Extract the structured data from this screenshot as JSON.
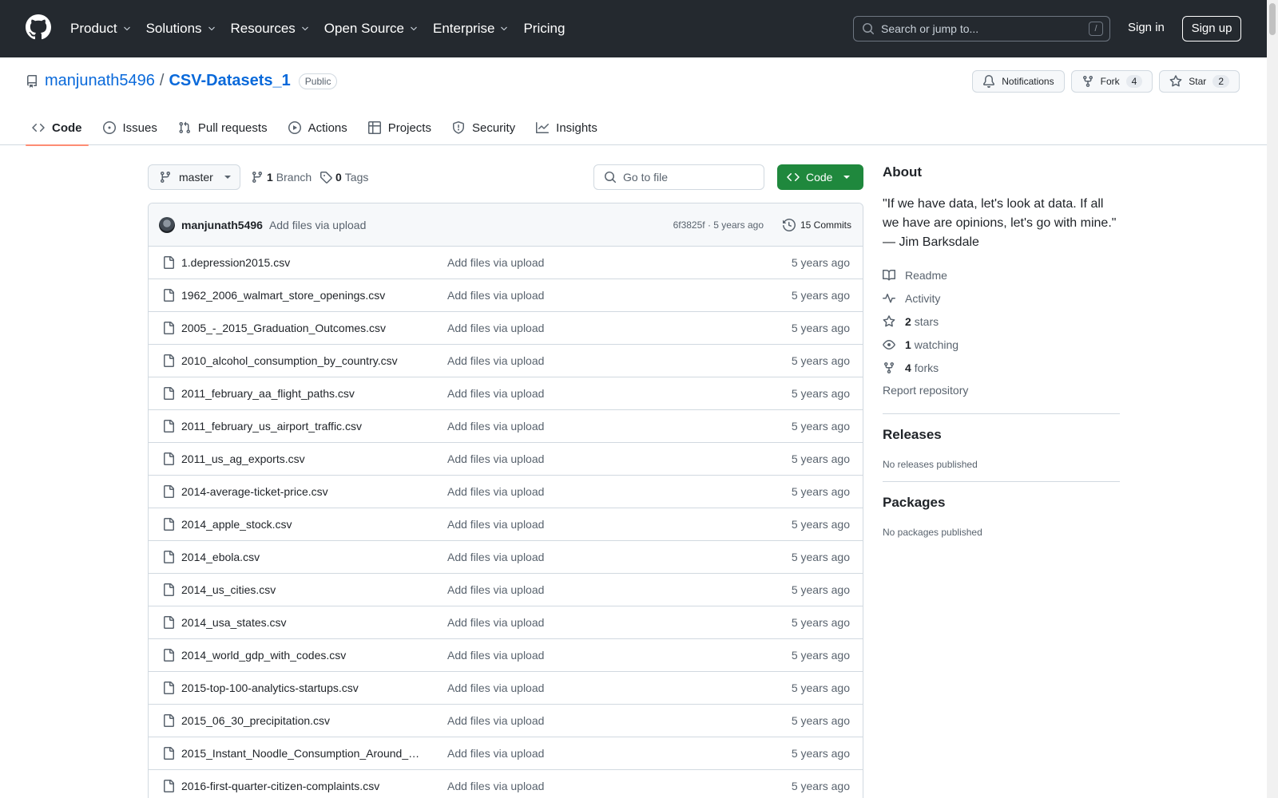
{
  "header": {
    "nav": [
      {
        "label": "Product",
        "has_menu": true
      },
      {
        "label": "Solutions",
        "has_menu": true
      },
      {
        "label": "Resources",
        "has_menu": true
      },
      {
        "label": "Open Source",
        "has_menu": true
      },
      {
        "label": "Enterprise",
        "has_menu": true
      },
      {
        "label": "Pricing",
        "has_menu": false
      }
    ],
    "search_placeholder": "Search or jump to...",
    "search_shortcut": "/",
    "sign_in": "Sign in",
    "sign_up": "Sign up"
  },
  "repo": {
    "owner": "manjunath5496",
    "separator": "/",
    "name": "CSV-Datasets_1",
    "visibility": "Public",
    "notifications_label": "Notifications",
    "fork_label": "Fork",
    "fork_count": "4",
    "star_label": "Star",
    "star_count": "2"
  },
  "tabs": [
    {
      "label": "Code",
      "icon": "code-icon",
      "active": true
    },
    {
      "label": "Issues",
      "icon": "issue-icon",
      "active": false
    },
    {
      "label": "Pull requests",
      "icon": "pull-request-icon",
      "active": false
    },
    {
      "label": "Actions",
      "icon": "play-icon",
      "active": false
    },
    {
      "label": "Projects",
      "icon": "table-icon",
      "active": false
    },
    {
      "label": "Security",
      "icon": "shield-icon",
      "active": false
    },
    {
      "label": "Insights",
      "icon": "graph-icon",
      "active": false
    }
  ],
  "toolbar": {
    "branch": "master",
    "branch_count": "1",
    "branch_label": "Branch",
    "tag_count": "0",
    "tag_label": "Tags",
    "goto_placeholder": "Go to file",
    "code_button": "Code"
  },
  "commit": {
    "author": "manjunath5496",
    "message": "Add files via upload",
    "meta": "6f3825f · 5 years ago",
    "commits_label": "15 Commits"
  },
  "files": [
    {
      "name": "1.depression2015.csv",
      "message": "Add files via upload",
      "age": "5 years ago"
    },
    {
      "name": "1962_2006_walmart_store_openings.csv",
      "message": "Add files via upload",
      "age": "5 years ago"
    },
    {
      "name": "2005_-_2015_Graduation_Outcomes.csv",
      "message": "Add files via upload",
      "age": "5 years ago"
    },
    {
      "name": "2010_alcohol_consumption_by_country.csv",
      "message": "Add files via upload",
      "age": "5 years ago"
    },
    {
      "name": "2011_february_aa_flight_paths.csv",
      "message": "Add files via upload",
      "age": "5 years ago"
    },
    {
      "name": "2011_february_us_airport_traffic.csv",
      "message": "Add files via upload",
      "age": "5 years ago"
    },
    {
      "name": "2011_us_ag_exports.csv",
      "message": "Add files via upload",
      "age": "5 years ago"
    },
    {
      "name": "2014-average-ticket-price.csv",
      "message": "Add files via upload",
      "age": "5 years ago"
    },
    {
      "name": "2014_apple_stock.csv",
      "message": "Add files via upload",
      "age": "5 years ago"
    },
    {
      "name": "2014_ebola.csv",
      "message": "Add files via upload",
      "age": "5 years ago"
    },
    {
      "name": "2014_us_cities.csv",
      "message": "Add files via upload",
      "age": "5 years ago"
    },
    {
      "name": "2014_usa_states.csv",
      "message": "Add files via upload",
      "age": "5 years ago"
    },
    {
      "name": "2014_world_gdp_with_codes.csv",
      "message": "Add files via upload",
      "age": "5 years ago"
    },
    {
      "name": "2015-top-100-analytics-startups.csv",
      "message": "Add files via upload",
      "age": "5 years ago"
    },
    {
      "name": "2015_06_30_precipitation.csv",
      "message": "Add files via upload",
      "age": "5 years ago"
    },
    {
      "name": "2015_Instant_Noodle_Consumption_Around_…",
      "message": "Add files via upload",
      "age": "5 years ago"
    },
    {
      "name": "2016-first-quarter-citizen-complaints.csv",
      "message": "Add files via upload",
      "age": "5 years ago"
    }
  ],
  "about": {
    "title": "About",
    "description": "\"If we have data, let's look at data. If all we have are opinions, let's go with mine.\" — Jim Barksdale",
    "readme": "Readme",
    "activity": "Activity",
    "stars_count": "2",
    "stars_label": "stars",
    "watching_count": "1",
    "watching_label": "watching",
    "forks_count": "4",
    "forks_label": "forks",
    "report": "Report repository"
  },
  "releases": {
    "title": "Releases",
    "empty": "No releases published"
  },
  "packages": {
    "title": "Packages",
    "empty": "No packages published"
  },
  "colors": {
    "accent": "#0969da",
    "primary_button": "#1f883d",
    "header_bg": "#24292f",
    "active_tab_underline": "#fd8c73"
  }
}
